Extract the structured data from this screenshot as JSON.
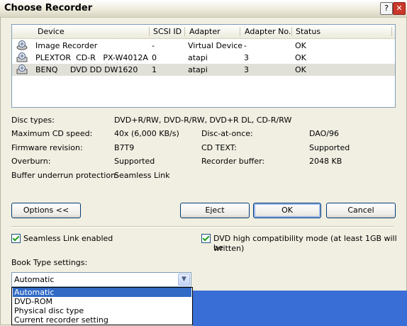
{
  "window": {
    "title": "Choose Recorder",
    "help_label": "?",
    "close_label": "✕"
  },
  "device_list": {
    "columns": [
      "Device",
      "SCSI ID",
      "Adapter",
      "Adapter No.",
      "Status"
    ],
    "rows": [
      {
        "device": "Image Recorder",
        "scsi_id": "-",
        "adapter": "Virtual Device",
        "adapter_no": "-",
        "status": "OK",
        "selected": false
      },
      {
        "device": "PLEXTOR  CD-R   PX-W4012A",
        "scsi_id": "0",
        "adapter": "atapi",
        "adapter_no": "3",
        "status": "OK",
        "selected": false
      },
      {
        "device": "BENQ     DVD DD DW1620",
        "scsi_id": "1",
        "adapter": "atapi",
        "adapter_no": "3",
        "status": "OK",
        "selected": true
      }
    ]
  },
  "info": {
    "disc_types_label": "Disc types:",
    "disc_types_value": "DVD+R/RW, DVD-R/RW, DVD+R DL, CD-R/RW",
    "max_speed_label": "Maximum CD speed:",
    "max_speed_value": "40x (6,000 KB/s)",
    "firmware_label": "Firmware revision:",
    "firmware_value": "B7T9",
    "overburn_label": "Overburn:",
    "overburn_value": "Supported",
    "buffer_label": "Buffer underrun protection:",
    "buffer_value": "Seamless Link",
    "disc_at_once_label": "Disc-at-once:",
    "disc_at_once_value": "DAO/96",
    "cd_text_label": "CD TEXT:",
    "cd_text_value": "Supported",
    "recorder_buffer_label": "Recorder buffer:",
    "recorder_buffer_value": "2048 KB"
  },
  "buttons": {
    "options": "Options <<",
    "eject": "Eject",
    "ok": "OK",
    "cancel": "Cancel"
  },
  "options": {
    "seamless_link": "Seamless Link enabled",
    "dvd_compat_line1": "DVD high compatibility mode (at least 1GB will be",
    "dvd_compat_line2": "written)",
    "book_type_label": "Book Type settings:",
    "book_type_value": "Automatic",
    "book_type_options": [
      "Automatic",
      "DVD-ROM",
      "Physical disc type",
      "Current recorder setting"
    ]
  },
  "colors": {
    "selection": "#316ac5",
    "taskbar_blue": "#3a6ed7"
  }
}
